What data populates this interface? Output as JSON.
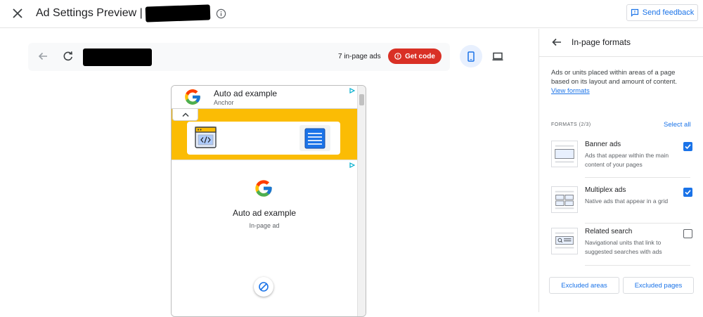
{
  "header": {
    "title": "Ad Settings Preview |",
    "feedback_label": "Send feedback"
  },
  "toolbar": {
    "ad_count": "7 in-page ads",
    "get_code_label": "Get code"
  },
  "preview": {
    "anchor_title": "Auto ad example",
    "anchor_subtitle": "Anchor",
    "inpage_title": "Auto ad example",
    "inpage_subtitle": "In-page ad"
  },
  "panel": {
    "title": "In-page formats",
    "description": "Ads or units placed within areas of a page based on its layout and amount of content.",
    "view_formats": "View formats",
    "formats_label": "FORMATS (2/3)",
    "select_all": "Select all",
    "formats": [
      {
        "name": "Banner ads",
        "description": "Ads that appear within the main content of your pages",
        "checked": true
      },
      {
        "name": "Multiplex ads",
        "description": "Native ads that appear in a grid",
        "checked": true
      },
      {
        "name": "Related search",
        "description": "Navigational units that link to suggested searches with ads",
        "checked": false
      }
    ],
    "excluded_areas": "Excluded areas",
    "excluded_pages": "Excluded pages"
  },
  "colors": {
    "accent": "#1a73e8",
    "get_code": "#d93025",
    "banner_yellow": "#fbbc04"
  },
  "icons": {
    "close": "close-icon",
    "info": "info-icon",
    "feedback": "feedback-icon",
    "back": "arrow-back-icon",
    "reload": "reload-icon",
    "error": "error-icon",
    "mobile": "mobile-icon",
    "desktop": "desktop-icon",
    "block": "block-icon"
  }
}
